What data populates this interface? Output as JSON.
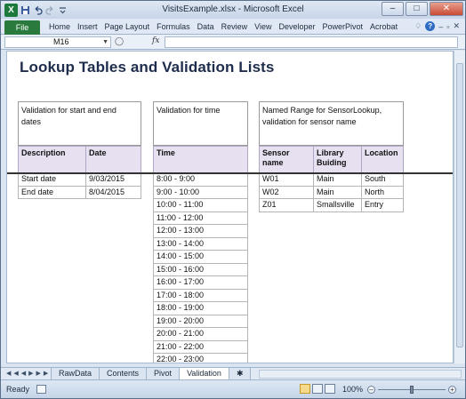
{
  "window": {
    "title": "VisitsExample.xlsx - Microsoft Excel",
    "app_logo": "X",
    "controls": {
      "minimize": "–",
      "maximize": "□",
      "close": "✕"
    }
  },
  "ribbon": {
    "file_tab": "File",
    "tabs": [
      "Home",
      "Insert",
      "Page Layout",
      "Formulas",
      "Data",
      "Review",
      "View",
      "Developer",
      "PowerPivot",
      "Acrobat"
    ]
  },
  "formula_bar": {
    "name_box": "M16",
    "fx_label": "fx",
    "formula": ""
  },
  "sheet": {
    "title": "Lookup Tables and Validation Lists",
    "validation_dates": {
      "header": "Validation for start and end dates",
      "columns": [
        "Description",
        "Date"
      ],
      "rows": [
        [
          "Start date",
          "9/03/2015"
        ],
        [
          "End date",
          "8/04/2015"
        ]
      ]
    },
    "validation_time": {
      "header": "Validation for time",
      "column": "Time",
      "rows": [
        "8:00 - 9:00",
        "9:00 - 10:00",
        "10:00 - 11:00",
        "11:00 - 12:00",
        "12:00 - 13:00",
        "13:00 - 14:00",
        "14:00 - 15:00",
        "15:00 - 16:00",
        "16:00 - 17:00",
        "17:00 - 18:00",
        "18:00 - 19:00",
        "19:00 - 20:00",
        "20:00 - 21:00",
        "21:00 - 22:00",
        "22:00 - 23:00"
      ]
    },
    "sensor_lookup": {
      "header": "Named Range for SensorLookup, validation for sensor name",
      "columns": [
        "Sensor name",
        "Library Buiding",
        "Location"
      ],
      "rows": [
        [
          "W01",
          "Main",
          "South"
        ],
        [
          "W02",
          "Main",
          "North"
        ],
        [
          "Z01",
          "Smallsville",
          "Entry"
        ]
      ]
    }
  },
  "sheet_tabs": {
    "tabs": [
      "RawData",
      "Contents",
      "Pivot",
      "Validation"
    ],
    "active": "Validation"
  },
  "status_bar": {
    "status": "Ready",
    "zoom": "100%"
  }
}
